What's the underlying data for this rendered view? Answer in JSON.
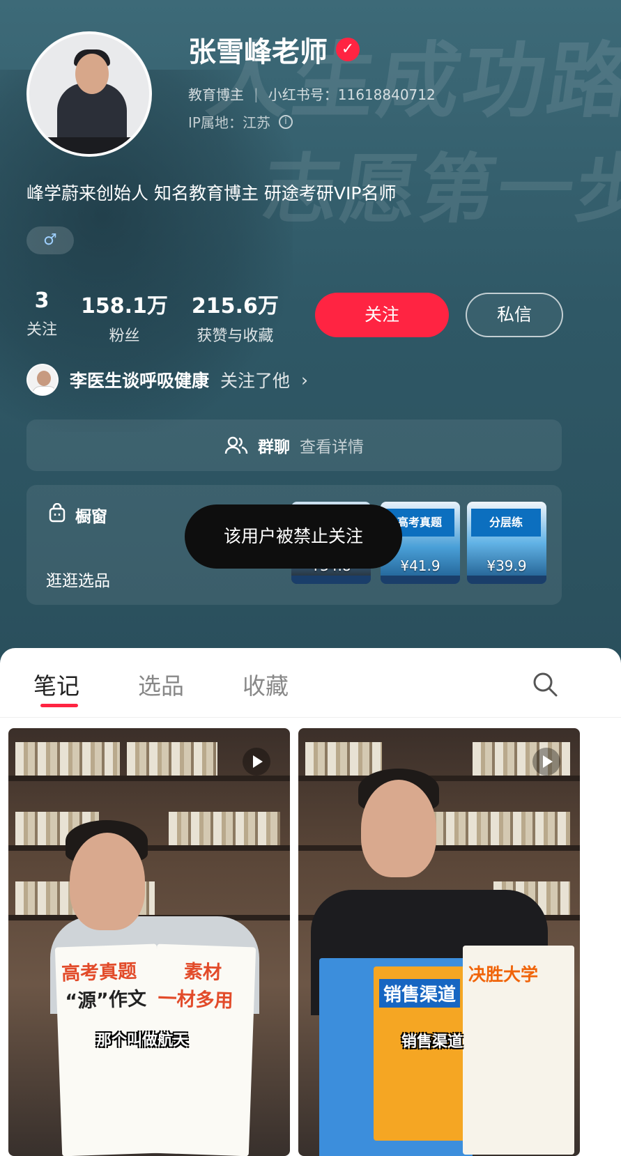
{
  "profile": {
    "name": "张雪峰老师",
    "verified_icon": "verified-check-icon",
    "category": "教育博主",
    "redbook_id": "小红书号：11618840712",
    "ip_location": "IP属地：江苏",
    "bio": "峰学蔚来创始人 知名教育博主 研途考研VIP名师",
    "gender_symbol": "♂",
    "background_text": [
      "人生成功路",
      "志愿第一步"
    ]
  },
  "stats": [
    {
      "value": "3",
      "label": "关注"
    },
    {
      "value": "158.1万",
      "label": "粉丝"
    },
    {
      "value": "215.6万",
      "label": "获赞与收藏"
    }
  ],
  "actions": {
    "follow": "关注",
    "message": "私信"
  },
  "recommend": {
    "name": "李医生谈呼吸健康",
    "action": "关注了他",
    "chevron": "›"
  },
  "group_chat": {
    "title": "群聊",
    "more": "查看详情"
  },
  "shop": {
    "title": "橱窗",
    "subtitle": "逛逛选品",
    "products": [
      {
        "tag": "",
        "price": "¥34.8"
      },
      {
        "tag": "高考真题",
        "price": "¥41.9"
      },
      {
        "tag": "分层练",
        "price": "¥39.9"
      }
    ]
  },
  "toast": "该用户被禁止关注",
  "tabs": [
    {
      "label": "笔记",
      "active": true
    },
    {
      "label": "选品",
      "active": false
    },
    {
      "label": "收藏",
      "active": false
    }
  ],
  "notes": [
    {
      "book_title_1": "高考真题",
      "book_title_2": "“源”作文",
      "book_title_3": "素材",
      "book_title_4": "一材多用",
      "caption": "那个叫做航天"
    },
    {
      "book_title_1": "销售渠道",
      "book_title_2": "决胜大学",
      "caption": "销售渠道"
    }
  ],
  "colors": {
    "accent": "#ff2442",
    "hero_bg": "#2e5663"
  }
}
